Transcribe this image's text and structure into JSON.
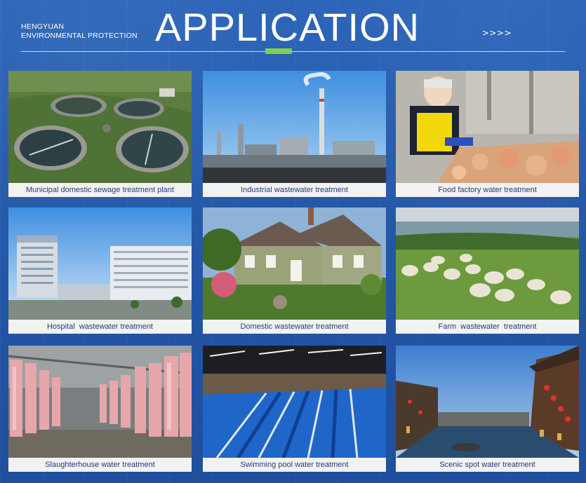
{
  "header": {
    "brand_line1": "HENGYUAN",
    "brand_line2": "ENVIRONMENTAL PROTECTION",
    "title": "APPLICATION",
    "arrows": ">>>>"
  },
  "colors": {
    "background": "#2458a9",
    "accent": "#7fd04a",
    "caption_bg": "#f2f2f2",
    "caption_text": "#1f3d78"
  },
  "applications": [
    {
      "label": "Municipal domestic sewage treatment plant",
      "icon": "sewage-plant-photo"
    },
    {
      "label": "Industrial wastewater treatment",
      "icon": "industrial-plant-photo"
    },
    {
      "label": "Food factory water treatment",
      "icon": "food-factory-photo"
    },
    {
      "label": "Hospital  wastewater treatment",
      "icon": "hospital-photo"
    },
    {
      "label": "Domestic wastewater treatment",
      "icon": "house-photo"
    },
    {
      "label": "Farm  wastewater  treatment",
      "icon": "farm-sheep-photo"
    },
    {
      "label": "Slaughterhouse water treatment",
      "icon": "slaughterhouse-photo"
    },
    {
      "label": "Swimming pool water treatment",
      "icon": "swimming-pool-photo"
    },
    {
      "label": "Scenic spot water treatment",
      "icon": "scenic-spot-photo"
    }
  ]
}
